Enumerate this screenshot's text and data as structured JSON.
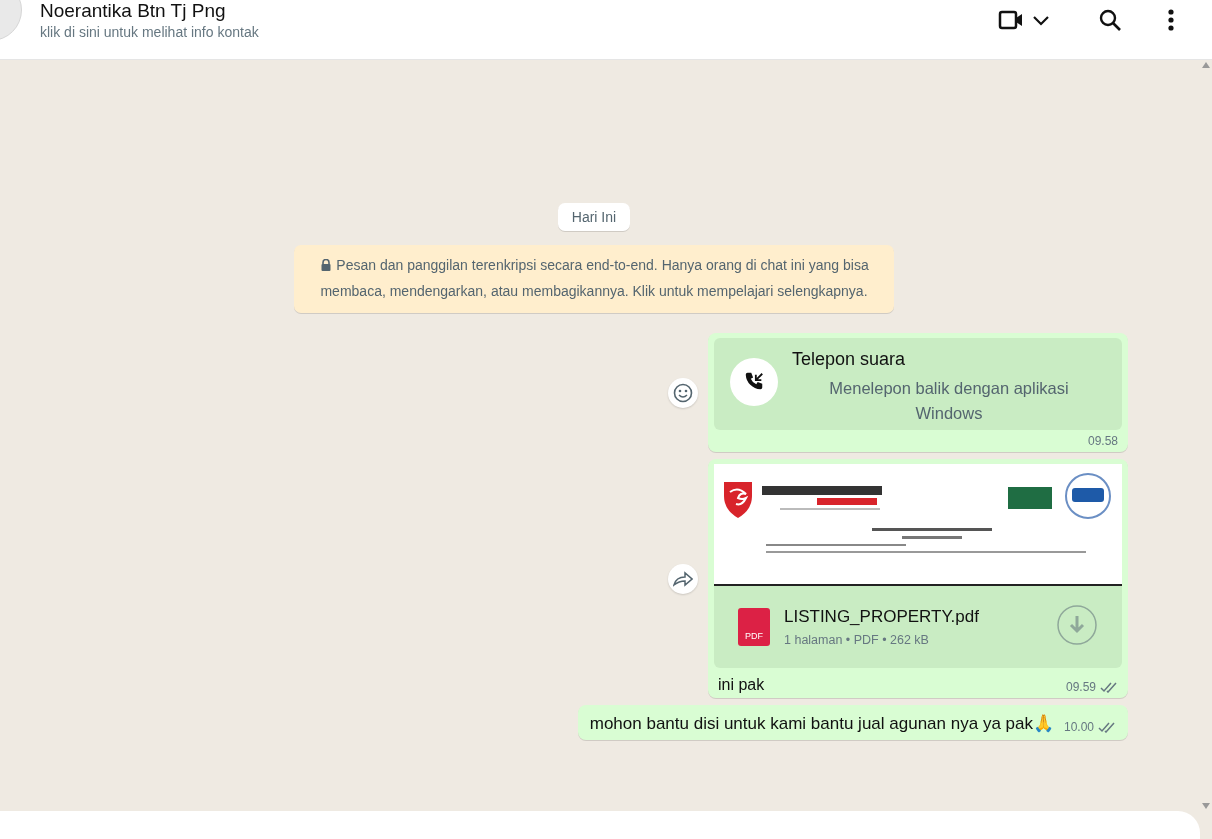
{
  "header": {
    "contact_name": "Noerantika Btn Tj Png",
    "subtitle": "klik di sini untuk melihat info kontak"
  },
  "date_chip": "Hari Ini",
  "encryption_notice": "Pesan dan panggilan terenkripsi secara end-to-end. Hanya orang di chat ini yang bisa membaca, mendengarkan, atau membagikannya. Klik untuk mempelajari selengkapnya.",
  "messages": [
    {
      "kind": "call",
      "title": "Telepon suara",
      "subtitle": "Menelepon balik dengan aplikasi Windows",
      "time": "09.58",
      "reaction_button": true
    },
    {
      "kind": "document",
      "file_name": "LISTING_PROPERTY.pdf",
      "file_type_badge": "PDF",
      "file_meta": "1 halaman • PDF • 262 kB",
      "caption": "ini pak",
      "time": "09.59",
      "read": true,
      "forward_button": true
    },
    {
      "kind": "text",
      "text": "mohon bantu disi untuk kami bantu jual agunan nya ya pak🙏",
      "time": "10.00",
      "read": true
    }
  ]
}
